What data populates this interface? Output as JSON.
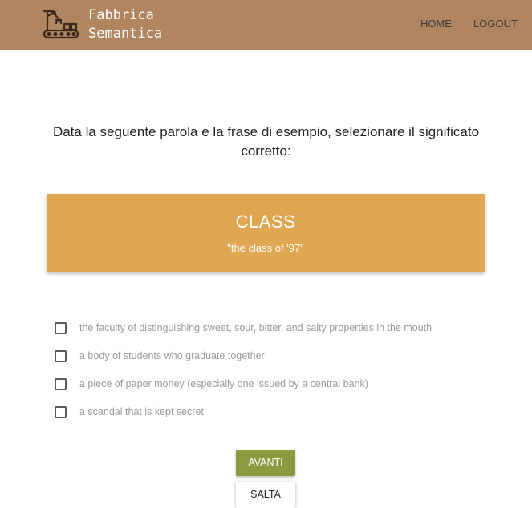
{
  "header": {
    "brand_line1": "Fabbrica",
    "brand_line2": "Semantica",
    "logo_icon": "factory-robot-arm-icon",
    "nav": [
      {
        "label": "HOME"
      },
      {
        "label": "LOGOUT"
      }
    ],
    "background_color": "#b08560"
  },
  "question": {
    "text": "Data la seguente parola e la frase di esempio, selezionare il significato corretto:"
  },
  "word_card": {
    "word": "CLASS",
    "example": "\"the class of '97\"",
    "background_color": "#e0a752"
  },
  "options": [
    {
      "label": "the faculty of distinguishing sweet, sour, bitter, and salty properties in the mouth",
      "checked": false
    },
    {
      "label": "a body of students who graduate together",
      "checked": false
    },
    {
      "label": "a piece of paper money (especially one issued by a central bank)",
      "checked": false
    },
    {
      "label": "a scandal that is kept secret",
      "checked": false
    }
  ],
  "buttons": {
    "next_label": "AVANTI",
    "skip_label": "SALTA",
    "next_color": "#8a9a3f"
  }
}
